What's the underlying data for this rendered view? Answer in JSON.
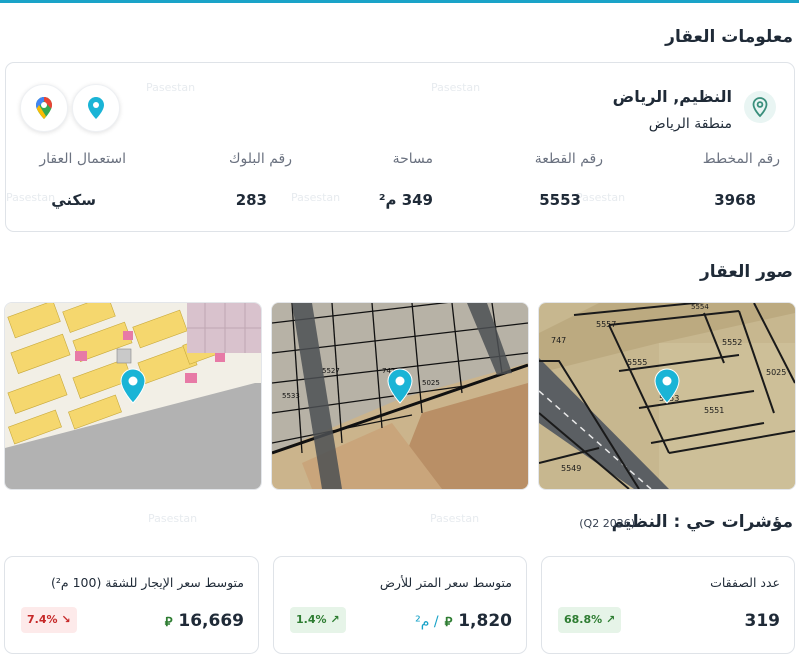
{
  "info_section": {
    "title": "معلومات العقار",
    "location_title": "النظيم, الرياض",
    "location_subtitle": "منطقة الرياض",
    "fields": [
      {
        "label": "رقم المخطط",
        "value": "3968"
      },
      {
        "label": "رقم القطعة",
        "value": "5553"
      },
      {
        "label": "مساحة",
        "value": "349 م²"
      },
      {
        "label": "رقم البلوك",
        "value": "283"
      },
      {
        "label": "استعمال العقار",
        "value": "سكني"
      }
    ],
    "location_icon": "map-pin-icon",
    "map_buttons": [
      "pin-map-icon",
      "google-maps-icon"
    ]
  },
  "images_section": {
    "title": "صور العقار",
    "images": [
      {
        "name": "satellite-close",
        "parcels": [
          "5557",
          "5555",
          "5552",
          "5553",
          "5551",
          "5025",
          "5549",
          "5554",
          "747"
        ]
      },
      {
        "name": "satellite-wide",
        "parcels": [
          "747",
          "5025",
          "5533",
          "5527"
        ]
      },
      {
        "name": "plan-map",
        "parcels": []
      }
    ]
  },
  "indicators_section": {
    "title": "مؤشرات حي : النظيم",
    "period": "(Q2 2026)",
    "cards": [
      {
        "label": "عدد الصفقات",
        "value": "319",
        "unit": "",
        "currency": "",
        "change": "68.8%",
        "trend": "up"
      },
      {
        "label": "متوسط سعر المتر للأرض",
        "value": "1,820",
        "unit": "/ م²",
        "currency": "⃁",
        "change": "1.4%",
        "trend": "up"
      },
      {
        "label": "متوسط سعر الإيجار للشقة (100 م²)",
        "value": "16,669",
        "unit": "",
        "currency": "⃁",
        "change": "7.4%",
        "trend": "down"
      }
    ]
  },
  "watermark": "Pasestan",
  "colors": {
    "accent": "#1aa3c8",
    "up": "#2e7d32",
    "down": "#c62828",
    "pin": "#1ab4d6"
  }
}
